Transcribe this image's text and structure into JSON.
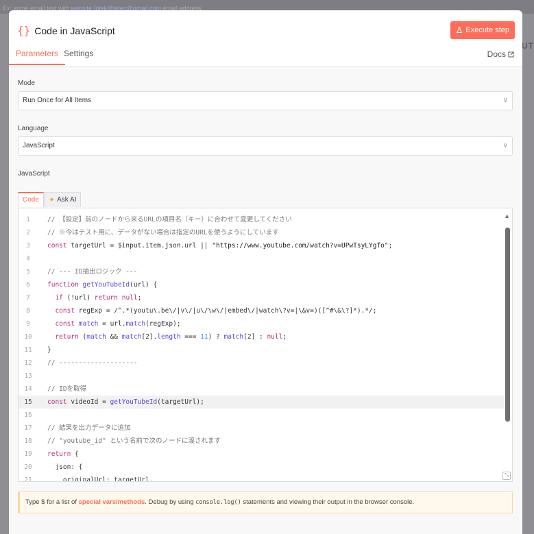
{
  "backdrop": {
    "top_prefix": "Ex: some email text with",
    "top_link": "website (olek@teleo@gmail.com",
    "top_suffix": "email address",
    "right_text": "UT"
  },
  "header": {
    "icon": "{}",
    "title": "Code in JavaScript",
    "execute_label": "Execute step"
  },
  "tabs": [
    {
      "label": "Parameters",
      "active": true
    },
    {
      "label": "Settings",
      "active": false
    }
  ],
  "docs_label": "Docs",
  "mode": {
    "label": "Mode",
    "value": "Run Once for All Items"
  },
  "language": {
    "label": "Language",
    "value": "JavaScript"
  },
  "code_section": {
    "label": "JavaScript",
    "tab_code": "Code",
    "tab_ai": "Ask AI"
  },
  "code": {
    "current_line": 15,
    "lines": [
      "// 【設定】前のノードから来るURLの項目名（キー）に合わせて変更してください",
      "// ※今はテスト用に、データがない場合は指定のURLを使うようにしています",
      "const targetUrl = $input.item.json.url || \"https://www.youtube.com/watch?v=UPwTsyLYgfo\";",
      "",
      "// --- ID抽出ロジック ---",
      "function getYouTubeId(url) {",
      "  if (!url) return null;",
      "  const regExp = /^.*(youtu\\.be\\/|v\\/|u\\/\\w\\/|embed\\/|watch\\?v=|\\&v=)([^#\\&\\?]*).*/;",
      "  const match = url.match(regExp);",
      "  return (match && match[2].length === 11) ? match[2] : null;",
      "}",
      "// --------------------",
      "",
      "// IDを取得",
      "const videoId = getYouTubeId(targetUrl);",
      "",
      "// 結果を出力データに追加",
      "// \"youtube_id\" という名前で次のノードに渡されます",
      "return {",
      "  json: {",
      "    originalUrl: targetUrl,"
    ]
  },
  "hint": {
    "prefix": "Type $ for a list of",
    "highlight": "special vars/methods",
    "middle": ". Debug by using",
    "code": "console.log()",
    "suffix": "statements and viewing their output in the browser console."
  }
}
